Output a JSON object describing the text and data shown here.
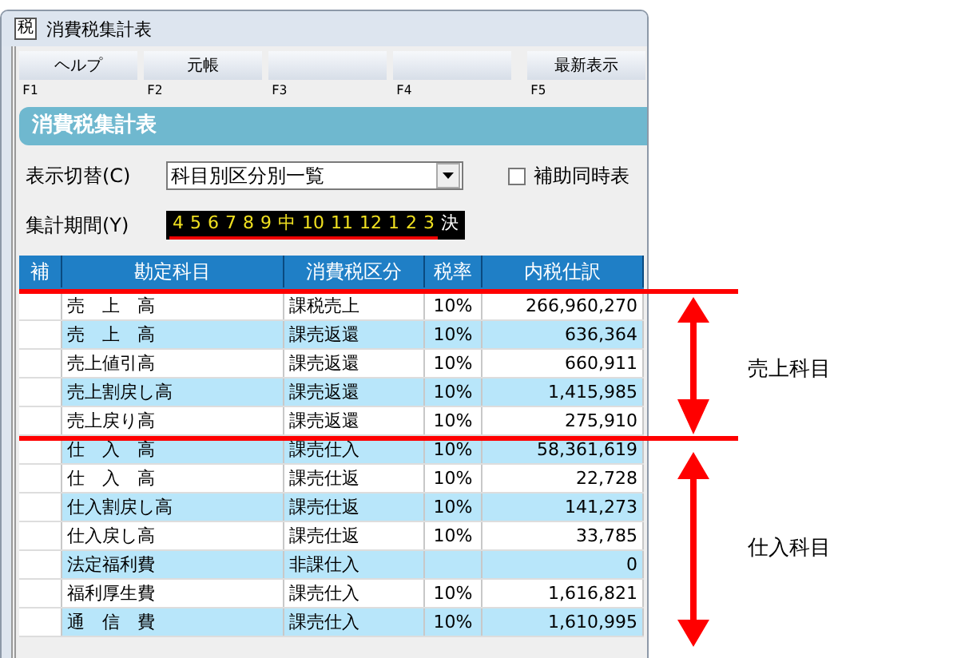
{
  "window": {
    "icon_text": "税",
    "title": "消費税集計表"
  },
  "function_keys": [
    {
      "label": "ヘルプ",
      "key": "F1"
    },
    {
      "label": "元帳",
      "key": "F2"
    },
    {
      "key": "F3"
    },
    {
      "key": "F4"
    },
    {
      "label": "最新表示",
      "key": "F5"
    }
  ],
  "header": "消費税集計表",
  "display_switch": {
    "label": "表示切替(C)",
    "value": "科目別区分別一覧"
  },
  "aux_checkbox": {
    "label": "補助同時表",
    "checked": false
  },
  "period": {
    "label": "集計期間(Y)",
    "months": [
      {
        "text": "4",
        "underlined": true
      },
      {
        "text": "5",
        "underlined": true
      },
      {
        "text": "6",
        "underlined": true
      },
      {
        "text": "7",
        "underlined": true
      },
      {
        "text": "8",
        "underlined": true
      },
      {
        "text": "9",
        "underlined": true
      },
      {
        "text": "中",
        "underlined": true
      },
      {
        "text": "10",
        "underlined": true
      },
      {
        "text": "11",
        "underlined": true
      },
      {
        "text": "12",
        "underlined": true
      },
      {
        "text": "1",
        "underlined": true
      },
      {
        "text": "2",
        "underlined": true
      },
      {
        "text": "3",
        "underlined": true
      },
      {
        "text": "決",
        "underlined": false
      }
    ]
  },
  "table": {
    "columns": [
      "補",
      "勘定科目",
      "消費税区分",
      "税率",
      "内税仕訳"
    ],
    "rows": [
      {
        "account": "売　上　高",
        "tax_class": "課税売上",
        "rate": "10%",
        "amount": "266,960,270"
      },
      {
        "account": "売　上　高",
        "tax_class": "課売返還",
        "rate": "10%",
        "amount": "636,364"
      },
      {
        "account": "売上値引高",
        "tax_class": "課売返還",
        "rate": "10%",
        "amount": "660,911"
      },
      {
        "account": "売上割戻し高",
        "tax_class": "課売返還",
        "rate": "10%",
        "amount": "1,415,985"
      },
      {
        "account": "売上戻り高",
        "tax_class": "課売返還",
        "rate": "10%",
        "amount": "275,910"
      },
      {
        "account": "仕　入　高",
        "tax_class": "課売仕入",
        "rate": "10%",
        "amount": "58,361,619"
      },
      {
        "account": "仕　入　高",
        "tax_class": "課売仕返",
        "rate": "10%",
        "amount": "22,728"
      },
      {
        "account": "仕入割戻し高",
        "tax_class": "課売仕返",
        "rate": "10%",
        "amount": "141,273"
      },
      {
        "account": "仕入戻し高",
        "tax_class": "課売仕返",
        "rate": "10%",
        "amount": "33,785"
      },
      {
        "account": "法定福利費",
        "tax_class": "非課仕入",
        "amount": "0"
      },
      {
        "account": "福利厚生費",
        "tax_class": "課売仕入",
        "rate": "10%",
        "amount": "1,616,821"
      },
      {
        "account": "通　信　費",
        "tax_class": "課売仕入",
        "rate": "10%",
        "amount": "1,610,995"
      }
    ]
  },
  "annotations": [
    {
      "label": "売上科目"
    },
    {
      "label": "仕入科目"
    }
  ]
}
